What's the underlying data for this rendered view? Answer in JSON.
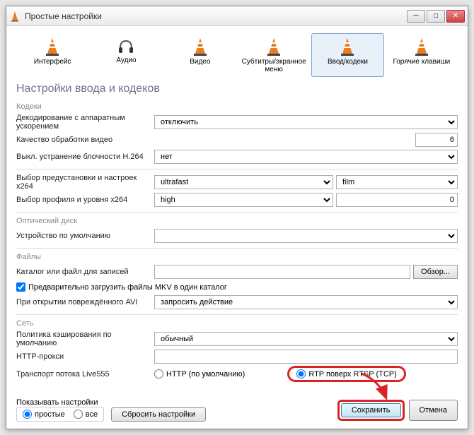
{
  "window": {
    "title": "Простые настройки"
  },
  "tabs": {
    "interface": "Интерфейс",
    "audio": "Аудио",
    "video": "Видео",
    "subtitles": "Субтитры/экранное меню",
    "input": "Ввод/кодеки",
    "hotkeys": "Горячие клавиши"
  },
  "section": {
    "title": "Настройки ввода и кодеков"
  },
  "codecs": {
    "group": "Кодеки",
    "hw_decode_label": "Декодирование с аппаратным ускорением",
    "hw_decode_value": "отключить",
    "quality_label": "Качество обработки видео",
    "quality_value": "6",
    "deblock_label": "Выкл. устранение блочности H.264",
    "deblock_value": "нет",
    "x264_preset_label": "Выбор предустановки и настроек x264",
    "x264_preset_value": "ultrafast",
    "x264_tune_value": "film",
    "x264_profile_label": "Выбор профиля и уровня x264",
    "x264_profile_value": "high",
    "x264_level_value": "0"
  },
  "optical": {
    "group": "Оптический диск",
    "device_label": "Устройство по умолчанию",
    "device_value": ""
  },
  "files": {
    "group": "Файлы",
    "record_label": "Каталог или файл для записей",
    "record_value": "",
    "browse": "Обзор...",
    "mkv_preload": "Предварительно загрузить файлы MKV в один каталог",
    "mkv_checked": true,
    "avi_label": "При открытии повреждённого AVI",
    "avi_value": "запросить действие"
  },
  "network": {
    "group": "Сеть",
    "cache_label": "Политика кэширования по умолчанию",
    "cache_value": "обычный",
    "proxy_label": "HTTP-прокси",
    "proxy_value": "",
    "transport_label": "Транспорт потока Live555",
    "transport_http": "HTTP (по умолчанию)",
    "transport_rtp": "RTP поверх RTSP (TCP)"
  },
  "footer": {
    "show_label": "Показывать настройки",
    "simple": "простые",
    "all": "все",
    "reset": "Сбросить настройки",
    "save": "Сохранить",
    "cancel": "Отмена"
  }
}
